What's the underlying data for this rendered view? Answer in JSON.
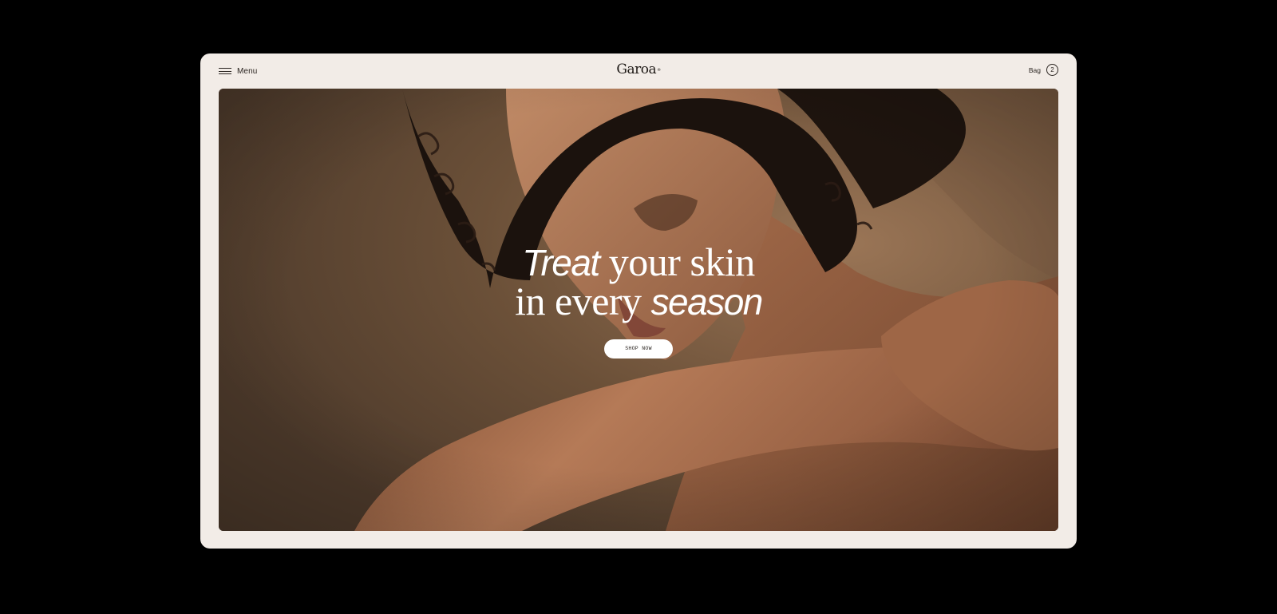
{
  "header": {
    "menu_label": "Menu",
    "brand": "Garoa",
    "brand_mark": "®",
    "bag_label": "Bag",
    "bag_count": "2"
  },
  "hero": {
    "headline_line1_italic": "Treat",
    "headline_line1_rest": " your skin",
    "headline_line2_start": "in every ",
    "headline_line2_italic": "season",
    "cta_label": "SHOP NOW",
    "photo": "portrait-woman-resting-on-arm"
  },
  "colors": {
    "page_background": "#000000",
    "frame_background": "#f2ece7",
    "hero_backdrop": "#5a4534",
    "text_dark": "#2a2420",
    "text_light": "#ffffff"
  },
  "icons": {
    "menu": "hamburger-icon"
  }
}
